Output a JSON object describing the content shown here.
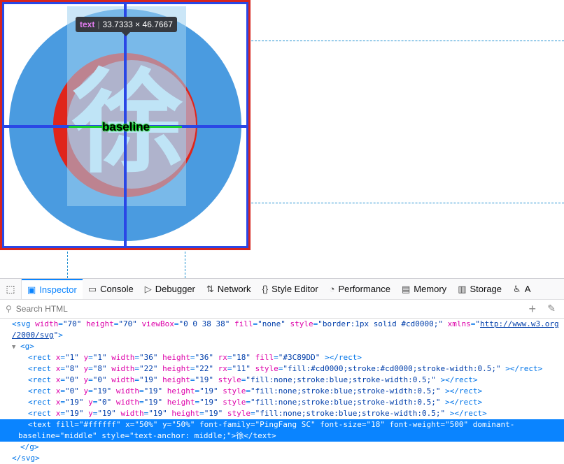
{
  "tooltip": {
    "tag": "text",
    "size": "33.7333 × 46.7667"
  },
  "viewport": {
    "glyph": "徐",
    "baseline_label": "baseline"
  },
  "toolbar": {
    "tabs": [
      {
        "label": "Inspector",
        "icon": "inspector-icon"
      },
      {
        "label": "Console",
        "icon": "console-icon"
      },
      {
        "label": "Debugger",
        "icon": "debugger-icon"
      },
      {
        "label": "Network",
        "icon": "network-icon"
      },
      {
        "label": "Style Editor",
        "icon": "style-editor-icon"
      },
      {
        "label": "Performance",
        "icon": "performance-icon"
      },
      {
        "label": "Memory",
        "icon": "memory-icon"
      },
      {
        "label": "Storage",
        "icon": "storage-icon"
      },
      {
        "label": "A",
        "icon": "accessibility-icon"
      }
    ]
  },
  "search": {
    "placeholder": "Search HTML"
  },
  "markup": {
    "svg_open": "<svg",
    "svg_attrs": [
      {
        "name": "width",
        "value": "\"70\""
      },
      {
        "name": "height",
        "value": "\"70\""
      },
      {
        "name": "viewBox",
        "value": "\"0 0 38 38\""
      },
      {
        "name": "fill",
        "value": "\"none\""
      },
      {
        "name": "style",
        "value": "\"border:1px solid #cd0000;\""
      }
    ],
    "xmlns_name": "xmlns",
    "xmlns_value_1": "http://www.w3.org",
    "xmlns_value_2": "/2000/svg",
    "g_open": "<g>",
    "rects": [
      {
        "x": "\"1\"",
        "y": "\"1\"",
        "w": "\"36\"",
        "h": "\"36\"",
        "extra_name": "rx",
        "extra": "\"18\"",
        "last_name": "fill",
        "last": "\"#3C89DD\""
      },
      {
        "x": "\"8\"",
        "y": "\"8\"",
        "w": "\"22\"",
        "h": "\"22\"",
        "extra_name": "rx",
        "extra": "\"11\"",
        "last_name": "style",
        "last": "\"fill:#cd0000;stroke:#cd0000;stroke-width:0.5;\""
      },
      {
        "x": "\"0\"",
        "y": "\"0\"",
        "w": "\"19\"",
        "h": "\"19\"",
        "extra_name": "",
        "extra": "",
        "last_name": "style",
        "last": "\"fill:none;stroke:blue;stroke-width:0.5;\""
      },
      {
        "x": "\"0\"",
        "y": "\"19\"",
        "w": "\"19\"",
        "h": "\"19\"",
        "extra_name": "",
        "extra": "",
        "last_name": "style",
        "last": "\"fill:none;stroke:blue;stroke-width:0.5;\""
      },
      {
        "x": "\"19\"",
        "y": "\"0\"",
        "w": "\"19\"",
        "h": "\"19\"",
        "extra_name": "",
        "extra": "",
        "last_name": "style",
        "last": "\"fill:none;stroke:blue;stroke-width:0.5;\""
      },
      {
        "x": "\"19\"",
        "y": "\"19\"",
        "w": "\"19\"",
        "h": "\"19\"",
        "extra_name": "",
        "extra": "",
        "last_name": "style",
        "last": "\"fill:none;stroke:blue;stroke-width:0.5;\""
      }
    ],
    "text_line_1": "<text fill=\"#ffffff\" x=\"50%\" y=\"50%\" font-family=\"PingFang SC\" font-size=\"18\" font-weight=\"500\" dominant-",
    "text_line_2": "baseline=\"middle\" style=\"text-anchor: middle;\">徐</text>",
    "g_close": "</g>",
    "svg_close": "</svg>"
  },
  "colors": {
    "accent": "#0a84ff",
    "frame_red": "#d6261f",
    "circle_blue": "#4a9be0",
    "grid_blue": "#2a47e6",
    "baseline_green": "#18d02c"
  }
}
